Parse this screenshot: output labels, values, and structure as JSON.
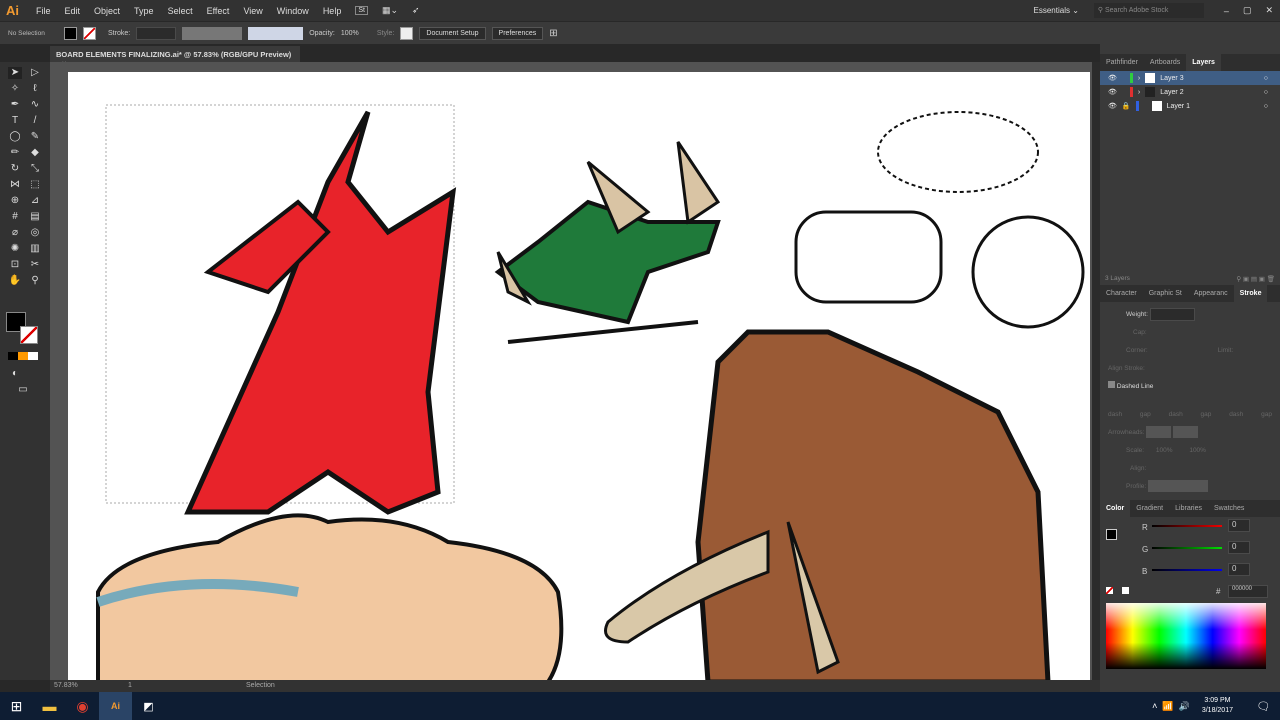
{
  "app": {
    "logo": "Ai",
    "menu": [
      "File",
      "Edit",
      "Object",
      "Type",
      "Select",
      "Effect",
      "View",
      "Window",
      "Help"
    ],
    "workspace": "Essentials",
    "search_placeholder": "Search Adobe Stock"
  },
  "control": {
    "selection": "No Selection",
    "stroke_label": "Stroke:",
    "opacity_label": "Opacity:",
    "opacity": "100%",
    "style_label": "Style:",
    "doc_setup": "Document Setup",
    "preferences": "Preferences"
  },
  "document": {
    "tab_title": "BOARD ELEMENTS FINALIZING.ai* @ 57.83% (RGB/GPU Preview)"
  },
  "layers": {
    "tabs": [
      "Pathfinder",
      "Artboards",
      "Layers"
    ],
    "items": [
      {
        "name": "Layer 3",
        "color": "#2ecc40"
      },
      {
        "name": "Layer 2",
        "color": "#e03030"
      },
      {
        "name": "Layer 1",
        "color": "#3060e0"
      }
    ],
    "count": "3 Layers"
  },
  "stroke": {
    "tabs": [
      "Character",
      "Graphic St",
      "Appearanc",
      "Stroke"
    ],
    "weight_label": "Weight:",
    "cap": "Cap:",
    "corner": "Corner:",
    "limit": "Limit:",
    "align": "Align Stroke:",
    "dashed": "Dashed Line",
    "dash_labels": [
      "dash",
      "gap",
      "dash",
      "gap",
      "dash",
      "gap"
    ],
    "arrowheads": "Arrowheads:",
    "scale": "Scale:",
    "scale_vals": [
      "100%",
      "100%"
    ],
    "align2": "Align:",
    "profile": "Profile:"
  },
  "color": {
    "tabs": [
      "Color",
      "Gradient",
      "Libraries",
      "Swatches"
    ],
    "r": "0",
    "g": "0",
    "b": "0",
    "r_label": "R",
    "g_label": "G",
    "b_label": "B",
    "hex_label": "#",
    "hex": "000000"
  },
  "status": {
    "zoom": "57.83%",
    "artboard": "1",
    "tool": "Selection"
  },
  "taskbar": {
    "time": "3:09 PM",
    "date": "3/18/2017"
  }
}
